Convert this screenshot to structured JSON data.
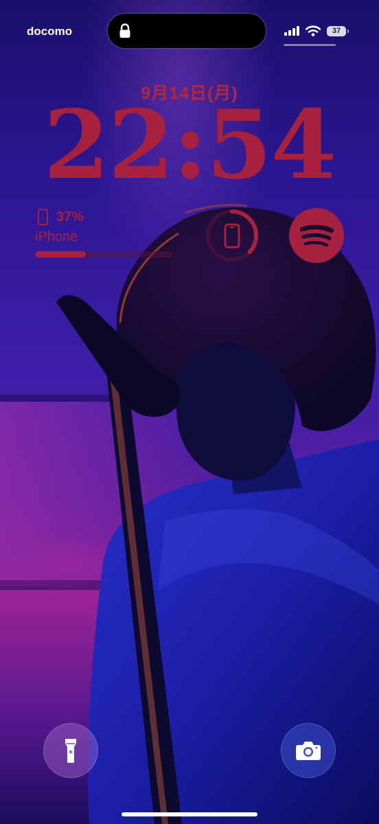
{
  "status_bar": {
    "carrier": "docomo",
    "battery_level": "37",
    "signal_icon": "cellular-signal-icon",
    "wifi_icon": "wifi-icon",
    "lock_icon": "lock-icon"
  },
  "lock_screen": {
    "date": "9月14日(月)",
    "time": "22:54",
    "accent_color": "#a5213e"
  },
  "widgets": {
    "battery": {
      "percent_text": "37%",
      "device_label": "iPhone",
      "level": 0.37,
      "icon": "phone-battery-icon"
    },
    "battery_ring": {
      "icon": "phone-icon",
      "level": 0.37
    },
    "spotify": {
      "icon": "spotify-icon"
    }
  },
  "bottom_controls": {
    "flashlight_icon": "flashlight-icon",
    "camera_icon": "camera-icon"
  }
}
